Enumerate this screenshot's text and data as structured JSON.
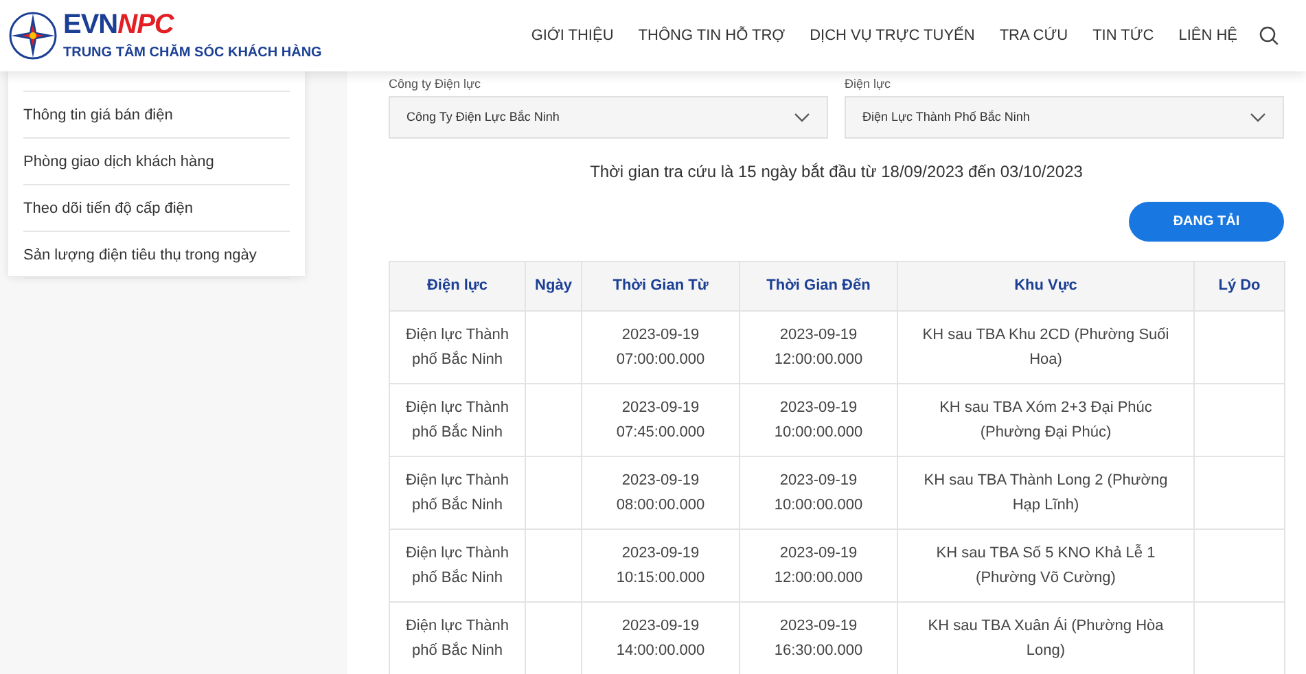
{
  "header": {
    "brand_main": "EVN",
    "brand_accent": "NPC",
    "brand_subtitle": "TRUNG TÂM CHĂM SÓC KHÁCH HÀNG",
    "nav": [
      "GIỚI THIỆU",
      "THÔNG TIN HỖ TRỢ",
      "DỊCH VỤ TRỰC TUYẾN",
      "TRA CỨU",
      "TIN TỨC",
      "LIÊN HỆ"
    ]
  },
  "sidebar": {
    "items": [
      "Thông tin giá bán điện",
      "Phòng giao dịch khách hàng",
      "Theo dõi tiến độ cấp điện",
      "Sản lượng điện tiêu thụ trong ngày"
    ]
  },
  "filters": [
    {
      "label": "Công ty Điện lực",
      "value": "Công Ty Điện Lực Bắc Ninh"
    },
    {
      "label": "Điện lực",
      "value": "Điện Lực Thành Phố Bắc Ninh"
    }
  ],
  "info": "Thời gian tra cứu là 15 ngày bắt đầu từ 18/09/2023 đến 03/10/2023",
  "load_button": "ĐANG TẢI",
  "table": {
    "columns": [
      "Điện lực",
      "Ngày",
      "Thời Gian Từ",
      "Thời Gian Đến",
      "Khu Vực",
      "Lý Do"
    ],
    "rows": [
      [
        "Điện lực Thành phố Bắc Ninh",
        "",
        "2023-09-19 07:00:00.000",
        "2023-09-19 12:00:00.000",
        "KH sau TBA Khu 2CD (Phường Suối Hoa)",
        ""
      ],
      [
        "Điện lực Thành phố Bắc Ninh",
        "",
        "2023-09-19 07:45:00.000",
        "2023-09-19 10:00:00.000",
        "KH sau TBA Xóm 2+3 Đại Phúc (Phường Đại Phúc)",
        ""
      ],
      [
        "Điện lực Thành phố Bắc Ninh",
        "",
        "2023-09-19 08:00:00.000",
        "2023-09-19 10:00:00.000",
        "KH sau TBA Thành Long 2 (Phường Hạp Lĩnh)",
        ""
      ],
      [
        "Điện lực Thành phố Bắc Ninh",
        "",
        "2023-09-19 10:15:00.000",
        "2023-09-19 12:00:00.000",
        "KH sau TBA Số 5 KNO Khả Lễ 1 (Phường Võ Cường)",
        ""
      ],
      [
        "Điện lực Thành phố Bắc Ninh",
        "",
        "2023-09-19 14:00:00.000",
        "2023-09-19 16:30:00.000",
        "KH sau TBA Xuân Ái (Phường Hòa Long)",
        ""
      ]
    ]
  }
}
